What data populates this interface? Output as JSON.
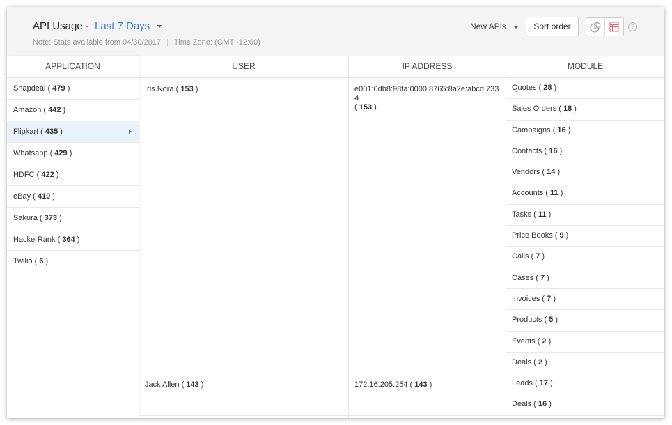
{
  "header": {
    "title": "API Usage -",
    "range": "Last 7 Days",
    "note": "Note: Stats available from 04/30/2017",
    "sep": "|",
    "timezone": "Time Zone: (GMT -12:00)",
    "filter": "New APIs",
    "sort_label": "Sort order",
    "help": "?"
  },
  "columns": {
    "application": "APPLICATION",
    "user": "USER",
    "ip": "IP ADDRESS",
    "module": "MODULE"
  },
  "applications": [
    {
      "name": "Snapdeal",
      "count": "479"
    },
    {
      "name": "Amazon",
      "count": "442"
    },
    {
      "name": "Flipkart",
      "count": "435",
      "selected": true
    },
    {
      "name": "Whatsapp",
      "count": "429"
    },
    {
      "name": "HDFC",
      "count": "422"
    },
    {
      "name": "eBay",
      "count": "410"
    },
    {
      "name": "Sakura",
      "count": "373"
    },
    {
      "name": "HackerRank",
      "count": "364"
    },
    {
      "name": "Twilio",
      "count": "6"
    }
  ],
  "users": [
    {
      "name": "Iris Nora",
      "count": "153",
      "ip": "e001:0db8:98fa:0000:8765:8a2e:abcd:7334",
      "ip_count": "153",
      "modules": [
        {
          "name": "Quotes",
          "count": "28"
        },
        {
          "name": "Sales Orders",
          "count": "18"
        },
        {
          "name": "Campaigns",
          "count": "16"
        },
        {
          "name": "Contacts",
          "count": "16"
        },
        {
          "name": "Vendors",
          "count": "14"
        },
        {
          "name": "Accounts",
          "count": "11"
        },
        {
          "name": "Tasks",
          "count": "11"
        },
        {
          "name": "Price Books",
          "count": "9"
        },
        {
          "name": "Calls",
          "count": "7"
        },
        {
          "name": "Cases",
          "count": "7"
        },
        {
          "name": "Invoices",
          "count": "7"
        },
        {
          "name": "Products",
          "count": "5"
        },
        {
          "name": "Events",
          "count": "2"
        },
        {
          "name": "Deals",
          "count": "2"
        }
      ]
    },
    {
      "name": "Jack Allen",
      "count": "143",
      "ip": "172.16.205.254",
      "ip_count": "143",
      "modules": [
        {
          "name": "Leads",
          "count": "17"
        },
        {
          "name": "Deals",
          "count": "16"
        }
      ]
    }
  ]
}
